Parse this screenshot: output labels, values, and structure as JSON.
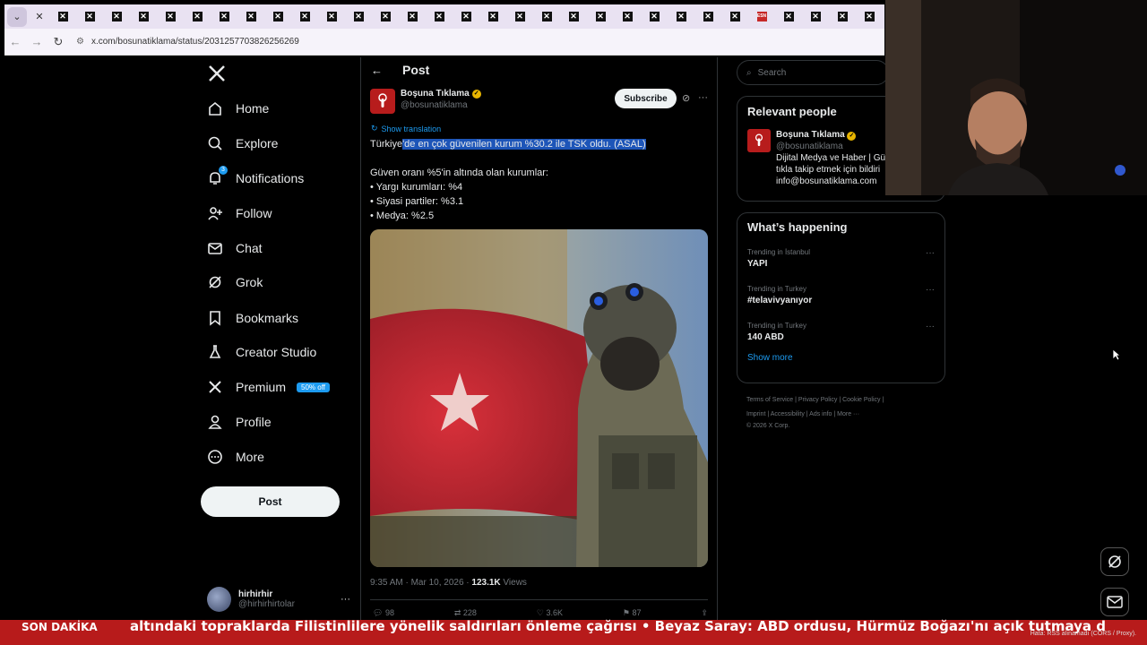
{
  "browser": {
    "url": "x.com/bosunatiklama/status/2031257703826256269",
    "active_tab_icon": "close-icon",
    "tab_count": 31,
    "special_tab_label": "ESN"
  },
  "sidebar": {
    "items": [
      {
        "label": "Home",
        "icon": "home-icon"
      },
      {
        "label": "Explore",
        "icon": "search-icon"
      },
      {
        "label": "Notifications",
        "icon": "bell-icon",
        "badge": "3"
      },
      {
        "label": "Follow",
        "icon": "add-user-icon"
      },
      {
        "label": "Chat",
        "icon": "mail-icon"
      },
      {
        "label": "Grok",
        "icon": "grok-icon"
      },
      {
        "label": "Bookmarks",
        "icon": "bookmark-icon"
      },
      {
        "label": "Creator Studio",
        "icon": "flask-icon"
      },
      {
        "label": "Premium",
        "icon": "x-icon",
        "tag": "50% off"
      },
      {
        "label": "Profile",
        "icon": "user-icon"
      },
      {
        "label": "More",
        "icon": "more-circle-icon"
      }
    ],
    "post_button": "Post",
    "account": {
      "name": "hirhirhir",
      "handle": "@hirhirhirtolar"
    }
  },
  "main": {
    "header_title": "Post",
    "author": {
      "name": "Boşuna Tıklama",
      "handle": "@bosunatiklama"
    },
    "subscribe": "Subscribe",
    "show_translation": "Show translation",
    "tweet": {
      "line1_pre": "Türkiye",
      "line1_hl": "'de en çok güvenilen kurum %30.2 ile TSK oldu. (ASAL)",
      "line2": "Güven oranı %5'in altında olan kurumlar:",
      "bullets": [
        "• Yargı kurumları: %4",
        "• Siyasi partiler: %3.1",
        "• Medya: %2.5"
      ]
    },
    "meta": {
      "time": "9:35 AM · Mar 10, 2026 · ",
      "views_count": "123.1K",
      "views_label": " Views"
    },
    "actions": {
      "replies": "98",
      "reposts": "228",
      "likes": "3.6K",
      "bookmarks": "87"
    }
  },
  "right": {
    "search_placeholder": "Search",
    "relevant": {
      "title": "Relevant people",
      "name": "Boşuna Tıklama",
      "handle": "@bosunatiklama",
      "bio1": "Dijital Medya ve Haber | Gü",
      "bio2": "tıkla takip etmek için bildiri",
      "bio3": "info@bosunatiklama.com"
    },
    "happening": {
      "title": "What’s happening",
      "trends": [
        {
          "context": "Trending in İstanbul",
          "topic": "YAPI"
        },
        {
          "context": "Trending in Turkey",
          "topic": "#telavivyanıyor"
        },
        {
          "context": "Trending in Turkey",
          "topic": "140 ABD"
        }
      ],
      "show_more": "Show more"
    },
    "footer": {
      "line1": "Terms of Service  |  Privacy Policy  |  Cookie Policy  |",
      "line2": "Imprint  |  Accessibility  |  Ads info  |  More ···",
      "line3": "© 2026 X Corp."
    }
  },
  "ticker": {
    "label": "SON DAKİKA",
    "text": "altındaki topraklarda Filistinlilere yönelik saldırıları önleme çağrısı   •   Beyaz Saray: ABD ordusu, Hürmüz Boğazı'nı açık tutmaya d",
    "error": "Hata: RSS alınamadı (CORS / Proxy)."
  },
  "colors": {
    "accent": "#1d9bf0",
    "ticker": "#b71b1b",
    "highlight": "#1d55b8"
  }
}
